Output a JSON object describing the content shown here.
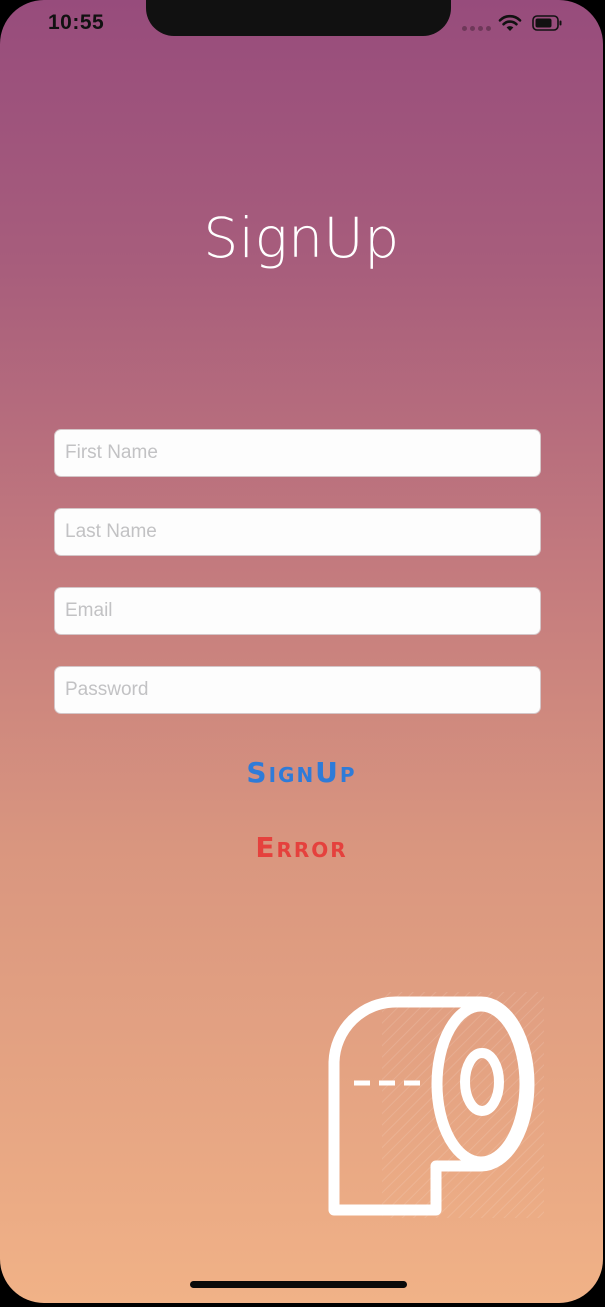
{
  "status_bar": {
    "time": "10:55"
  },
  "page": {
    "title": "SignUp"
  },
  "form": {
    "first_name_placeholder": "First Name",
    "last_name_placeholder": "Last Name",
    "email_placeholder": "Email",
    "password_placeholder": "Password",
    "signup_label": "SignUp",
    "error_label": "Error"
  },
  "icons": {
    "status": [
      "signal-dots-icon",
      "wifi-icon",
      "battery-icon"
    ],
    "illustration": "toilet-paper-roll-icon"
  },
  "colors": {
    "gradient_top": "#974c7c",
    "gradient_bottom": "#f1b287",
    "signup_button": "#2f7bd8",
    "error_text": "#e5413d",
    "title_text": "#ffffff"
  }
}
